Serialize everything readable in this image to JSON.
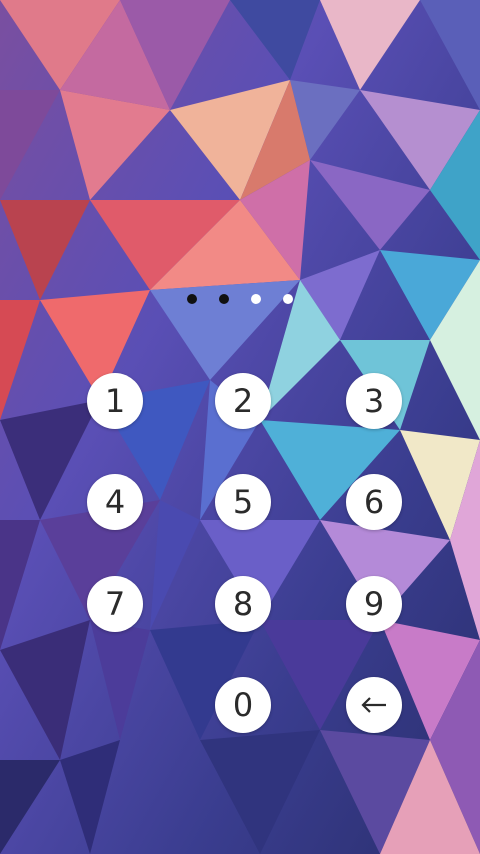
{
  "lock_screen": {
    "pin": {
      "length": 4,
      "entered": 2
    },
    "keypad": {
      "keys": [
        "1",
        "2",
        "3",
        "4",
        "5",
        "6",
        "7",
        "8",
        "9",
        "0"
      ],
      "backspace_icon": "backspace-arrow-icon"
    }
  },
  "colors": {
    "key_background": "#ffffff",
    "key_text": "#2b2b2b",
    "dot_filled": "#111111",
    "dot_empty": "#ffffff"
  }
}
